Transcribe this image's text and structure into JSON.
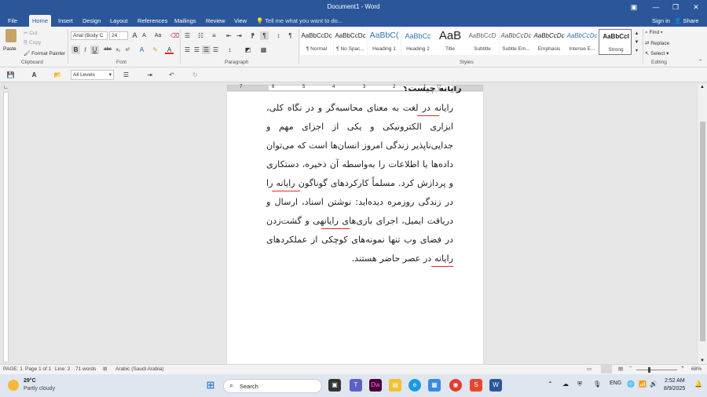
{
  "window": {
    "title": "Document1 - Word",
    "controls": {
      "ribbon_display": "▣",
      "minimize": "—",
      "restore": "❐",
      "close": "✕"
    }
  },
  "tabs": {
    "file": "File",
    "items": [
      "Home",
      "Insert",
      "Design",
      "Layout",
      "References",
      "Mailings",
      "Review",
      "View"
    ],
    "active": "Home",
    "tell_me": "Tell me what you want to do...",
    "sign_in": "Sign in",
    "share": "Share"
  },
  "clipboard": {
    "paste": "Paste",
    "cut": "Cut",
    "copy": "Copy",
    "format_painter": "Format Painter",
    "label": "Clipboard"
  },
  "font": {
    "name": "Arial (Body C",
    "size": "24",
    "label": "Font",
    "aa_grow": "A",
    "aa_shrink": "A",
    "change_case": "Aa",
    "bold": "B",
    "italic": "I",
    "underline": "U",
    "strike": "abc",
    "sub": "x₂",
    "sup": "x²"
  },
  "paragraph": {
    "label": "Paragraph",
    "pilcrow": "¶"
  },
  "styles": {
    "label": "Styles",
    "items": [
      {
        "sample": "AaBbCcDc",
        "name": "¶ Normal"
      },
      {
        "sample": "AaBbCcDc",
        "name": "¶ No Spac..."
      },
      {
        "sample": "AaBbC(",
        "name": "Heading 1"
      },
      {
        "sample": "AaBbCc",
        "name": "Heading 2"
      },
      {
        "sample": "AaB",
        "name": "Title"
      },
      {
        "sample": "AaBbCcD",
        "name": "Subtitle"
      },
      {
        "sample": "AaBbCcDc",
        "name": "Subtle Em..."
      },
      {
        "sample": "AaBbCcDc",
        "name": "Emphasis"
      },
      {
        "sample": "AaBbCcDc",
        "name": "Intense E..."
      },
      {
        "sample": "AaBbCcI",
        "name": "Strong"
      }
    ],
    "selected": "Strong"
  },
  "editing": {
    "label": "Editing",
    "find": "Find",
    "replace": "Replace",
    "select": "Select"
  },
  "quick_access": {
    "levels": "All Levels"
  },
  "document": {
    "cut_top_line": "رایانه چیست؟",
    "body": "رایانه در لغت به معنای محاسبه‌گر و در نگاه کلی، ابزاری الکترونیکی و یکی از اجزای مهم و جدایی‌ناپذیر زندگی امروز انسان‌ها است که می‌توان داده‌ها یا اطلاعات را به‌واسطه آن ذخیره، دستکاری و پردازش کرد. مسلماً کارکردهای گوناگون رایانه را در زندگی روزمره دیده‌اید: نوشتن اسناد، ارسال و دریافت ایمیل، اجرای بازی‌های رایانهی و گشت‌زدن در فضای وب تنها نمونه‌های کوچکی از عملکردهای رایانه در عصر حاضر هستند."
  },
  "ruler": {
    "numbers": [
      "7",
      "6",
      "5",
      "4",
      "3",
      "2",
      "1"
    ]
  },
  "status": {
    "page": "PAGE: 1",
    "page_of": "Page 1 of 1",
    "line": "Line: 2",
    "words": "71 words",
    "language": "Arabic (Saudi Arabia)",
    "zoom": "68%"
  },
  "taskbar": {
    "temperature": "29°C",
    "weather": "Partly cloudy",
    "search": "Search",
    "language": "ENG",
    "time": "2:52 AM",
    "date": "8/9/2025",
    "apps": [
      "Dw",
      "S",
      "W"
    ]
  },
  "colors": {
    "word_blue": "#2b579a",
    "ribbon_bg": "#f3f3f3",
    "spell_red": "#d62b2b"
  }
}
